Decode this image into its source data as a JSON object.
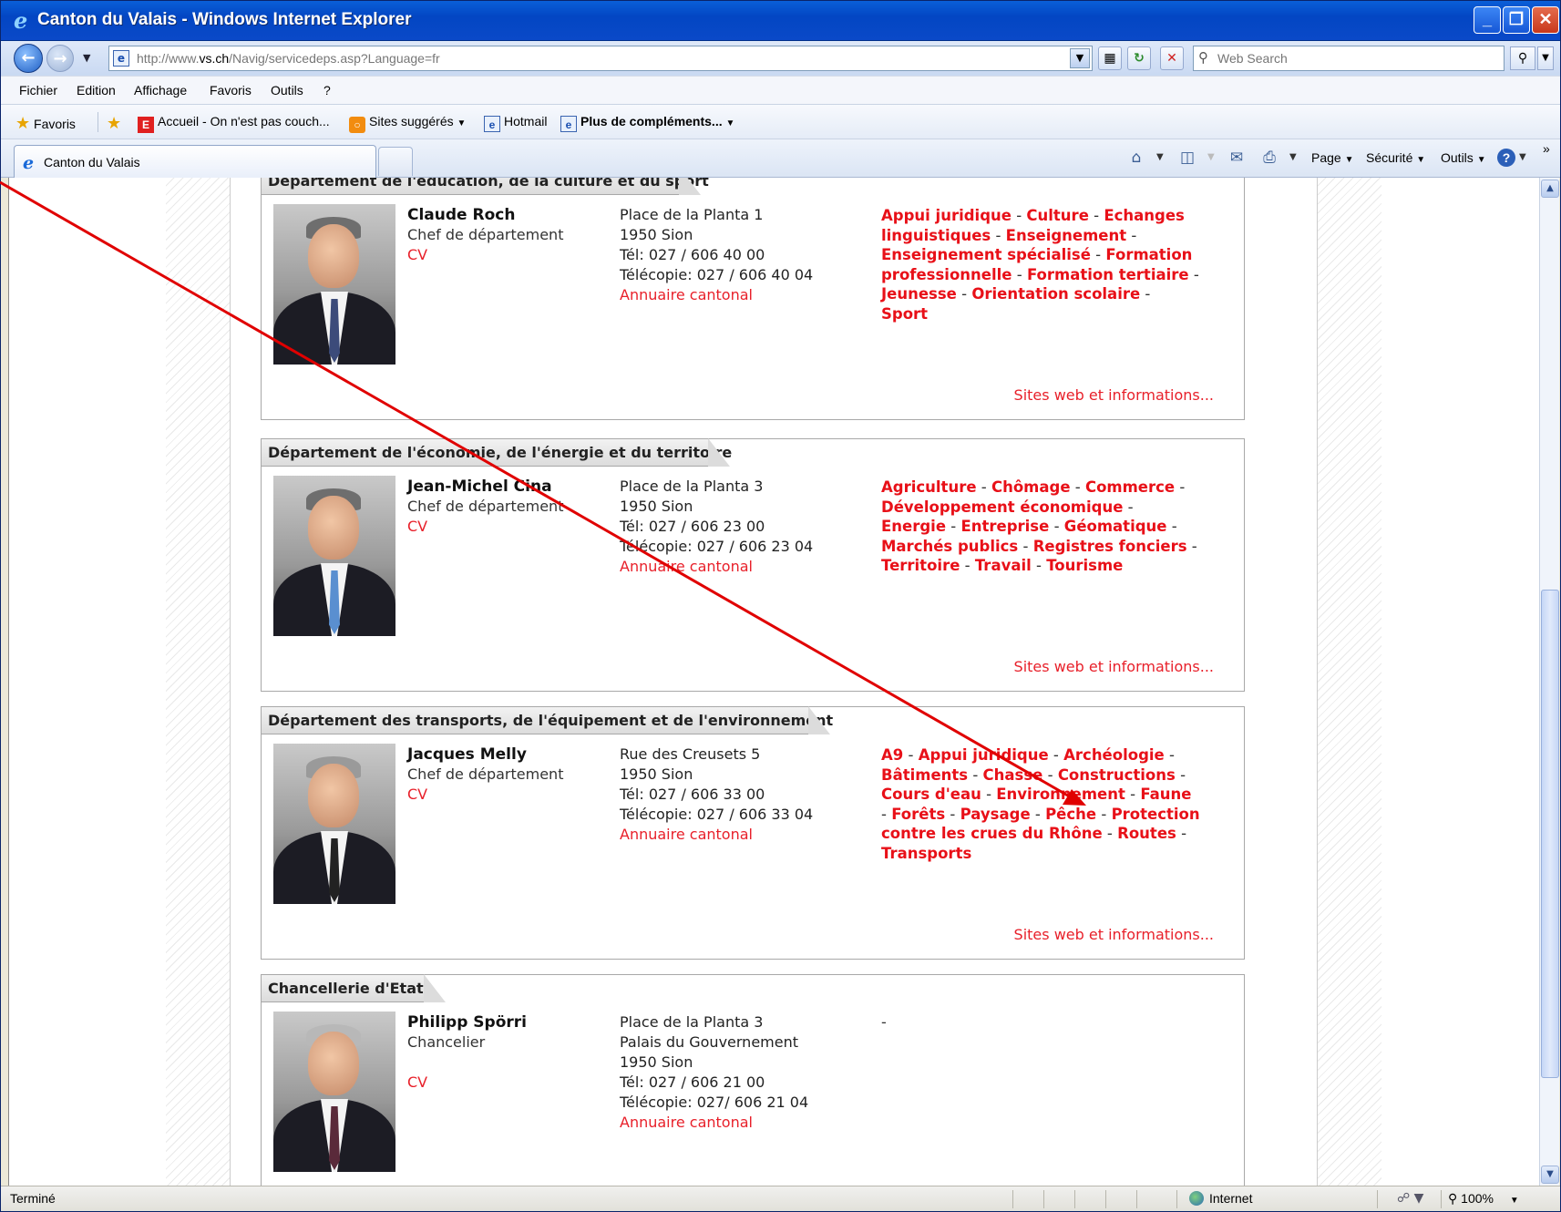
{
  "window": {
    "title": "Canton du Valais - Windows Internet Explorer",
    "minimize": "_",
    "maximize": "❐",
    "close": "✕"
  },
  "address": {
    "url_pre": "http://www.",
    "url_host": "vs.ch",
    "url_post": "/Navig/servicedeps.asp?Language=fr",
    "search_placeholder": "Web Search"
  },
  "menu": {
    "items": [
      "Fichier",
      "Edition",
      "Affichage",
      "Favoris",
      "Outils",
      "?"
    ]
  },
  "favorites": {
    "favoris_label": "Favoris",
    "items": [
      "Accueil - On n'est pas couch...",
      "Sites suggérés",
      "Hotmail",
      "Plus de compléments..."
    ]
  },
  "tabs": {
    "active_label": "Canton du Valais"
  },
  "command_bar": {
    "page": "Page",
    "securite": "Sécurité",
    "outils": "Outils",
    "help": "?",
    "chevron": "»"
  },
  "departments": [
    {
      "title": "Département de l'éducation, de la culture et du sport",
      "name": "Claude Roch",
      "role": "Chef de département",
      "cv": "CV",
      "address": [
        "Place de la Planta 1",
        "1950 Sion",
        "Tél: 027 / 606 40 00",
        "Télécopie: 027 / 606 40 04"
      ],
      "annuaire": "Annuaire cantonal",
      "topics": [
        "Appui juridique",
        "Culture",
        "Echanges linguistiques",
        "Enseignement",
        "Enseignement spécialisé",
        "Formation professionnelle",
        "Formation tertiaire",
        "Jeunesse",
        "Orientation scolaire",
        "Sport"
      ],
      "sites": "Sites web et informations..."
    },
    {
      "title": "Département de l'économie, de l'énergie et du territoire",
      "name": "Jean-Michel Cina",
      "role": "Chef de département",
      "cv": "CV",
      "address": [
        "Place de la Planta 3",
        "1950 Sion",
        "Tél: 027 / 606 23 00",
        "Télécopie: 027 / 606 23 04"
      ],
      "annuaire": "Annuaire cantonal",
      "topics": [
        "Agriculture",
        "Chômage",
        "Commerce",
        "Développement économique",
        "Energie",
        "Entreprise",
        "Géomatique",
        "Marchés publics",
        "Registres fonciers",
        "Territoire",
        "Travail",
        "Tourisme"
      ],
      "sites": "Sites web et informations..."
    },
    {
      "title": "Département des transports, de l'équipement et de l'environnement",
      "name": "Jacques Melly",
      "role": "Chef de département",
      "cv": "CV",
      "address": [
        "Rue des Creusets 5",
        "1950 Sion",
        "Tél: 027 / 606 33 00",
        "Télécopie: 027 / 606 33 04"
      ],
      "annuaire": "Annuaire cantonal",
      "topics": [
        "A9",
        "Appui juridique",
        "Archéologie",
        "Bâtiments",
        "Chasse",
        "Constructions",
        "Cours d'eau",
        "Environnement",
        "Faune",
        "Forêts",
        "Paysage",
        "Pêche",
        "Protection contre les crues du Rhône",
        "Routes",
        "Transports"
      ],
      "sites": "Sites web et informations..."
    },
    {
      "title": "Chancellerie d'Etat",
      "name": "Philipp Spörri",
      "role": "Chancelier",
      "cv": "CV",
      "address": [
        "Place de la Planta 3",
        "Palais du Gouvernement",
        "1950 Sion",
        "Tél: 027 / 606 21 00",
        "Télécopie: 027/ 606 21 04"
      ],
      "annuaire": "Annuaire cantonal",
      "topics_placeholder": "-"
    }
  ],
  "status": {
    "left": "Terminé",
    "zone": "Internet",
    "zoom": "100%"
  },
  "annotation_color": "#e00000"
}
